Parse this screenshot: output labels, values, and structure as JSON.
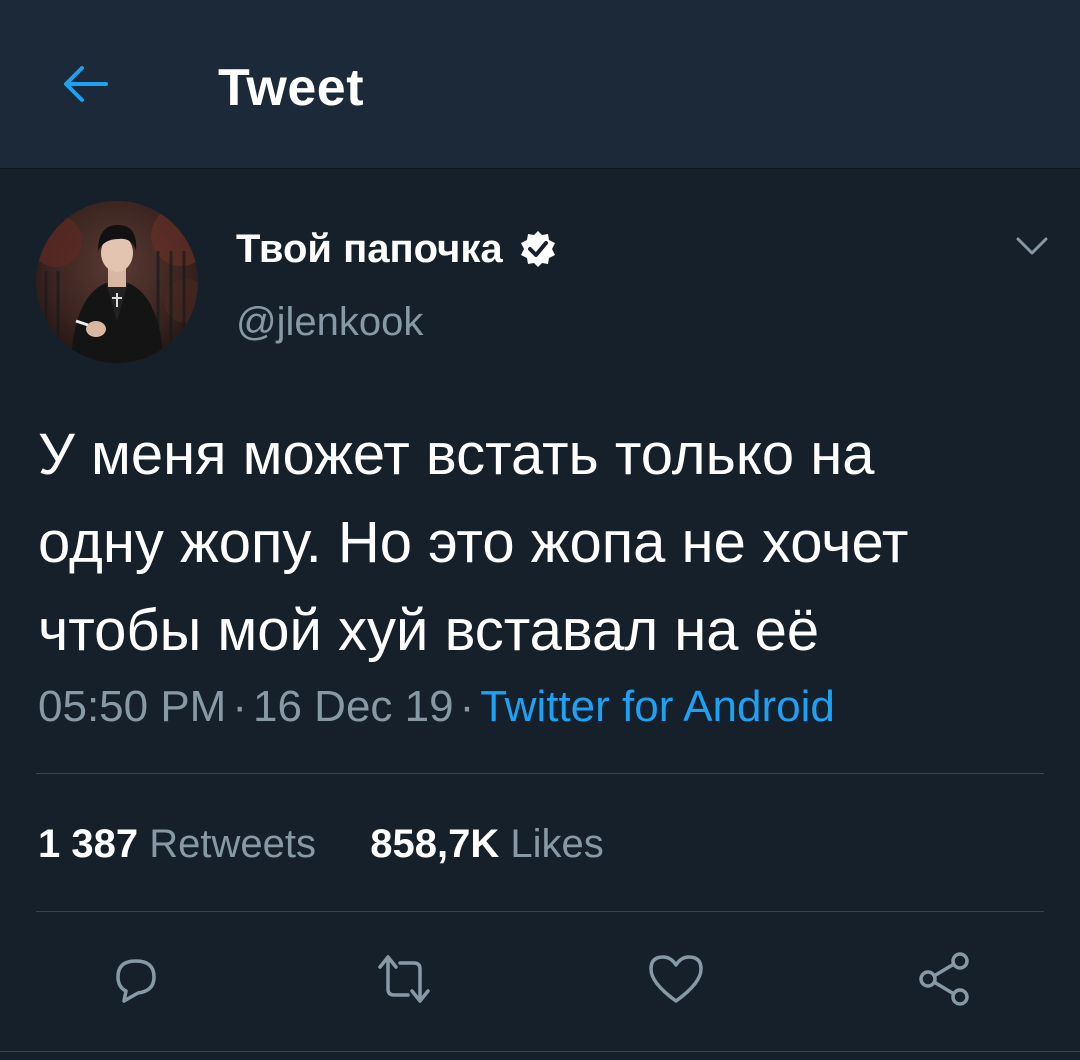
{
  "header": {
    "title": "Tweet",
    "back_icon": "arrow-left-icon",
    "accent_color": "#1da1f2"
  },
  "author": {
    "display_name": "Твой папочка",
    "handle": "@jlenkook",
    "verified": true,
    "verified_icon": "verified-badge-icon",
    "menu_icon": "chevron-down-icon"
  },
  "tweet": {
    "text": "У меня может встать только на\nодну жопу. Но это жопа не хочет\nчтобы мой хуй вставал на её",
    "time": "05:50 PM",
    "date": "16 Dec 19",
    "separator": "·",
    "source": "Twitter for Android"
  },
  "stats": {
    "retweets_count": "1 387",
    "retweets_label": "Retweets",
    "likes_count": "858,7K",
    "likes_label": "Likes"
  },
  "actions": {
    "reply_icon": "reply-icon",
    "retweet_icon": "retweet-icon",
    "like_icon": "heart-icon",
    "share_icon": "share-icon",
    "icon_color": "#8899a6"
  },
  "colors": {
    "background": "#15202b",
    "header_background": "#1c2938",
    "secondary_text": "#8899a6",
    "divider": "#38444d"
  }
}
